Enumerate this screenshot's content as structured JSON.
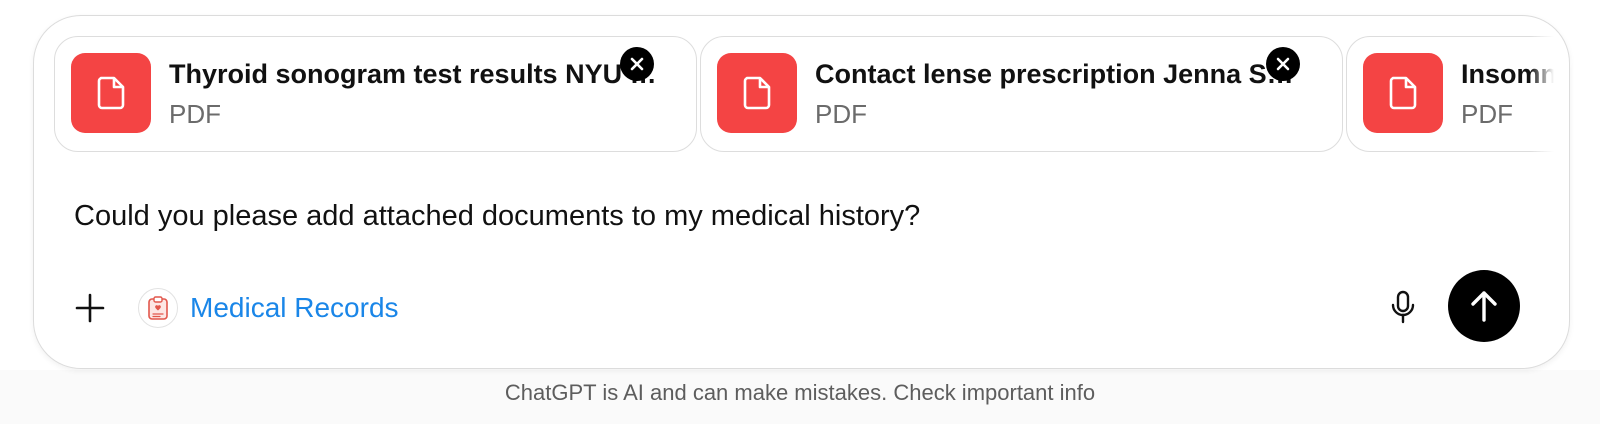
{
  "attachments": [
    {
      "name": "Thyroid sonogram test results NYU …",
      "type": "PDF",
      "icon": "document-icon"
    },
    {
      "name": "Contact lense prescription Jenna S…",
      "type": "PDF",
      "icon": "document-icon"
    },
    {
      "name": "Insomnia",
      "type": "PDF",
      "icon": "document-icon"
    }
  ],
  "composer": {
    "message": "Could you please add attached documents to my medical history?"
  },
  "tool": {
    "label": "Medical Records",
    "icon": "clipboard-heart-icon"
  },
  "icons": {
    "add": "plus-icon",
    "remove": "close-icon",
    "mic": "microphone-icon",
    "send": "arrow-up-icon"
  },
  "colors": {
    "file_icon_bg": "#f44444",
    "tool_label": "#1a86e8",
    "send_bg": "#000000"
  },
  "footer": {
    "disclaimer": "ChatGPT is AI and can make mistakes. Check important info"
  }
}
